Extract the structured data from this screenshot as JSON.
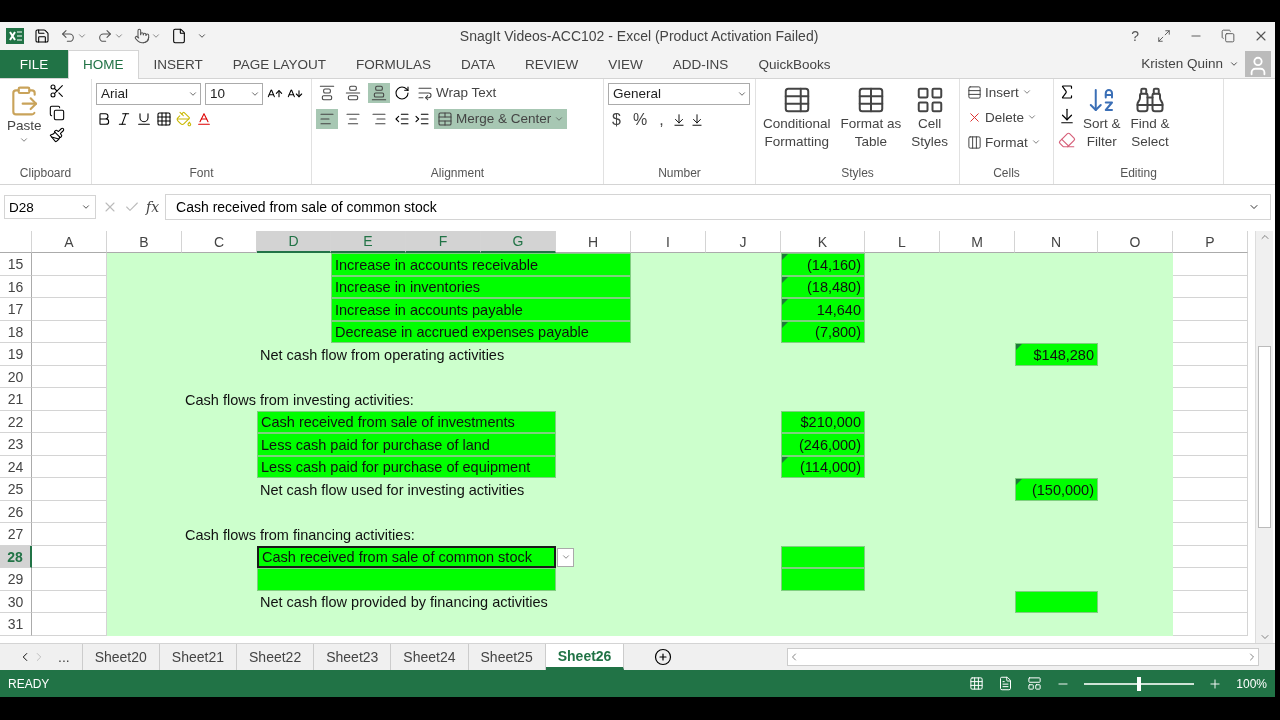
{
  "window": {
    "title": "SnagIt Videos-ACC102 - Excel (Product Activation Failed)",
    "help": "?"
  },
  "menu_tabs": [
    {
      "label": "FILE",
      "kind": "file",
      "selected": false
    },
    {
      "label": "HOME",
      "kind": "tab",
      "selected": true
    },
    {
      "label": "INSERT",
      "kind": "tab",
      "selected": false
    },
    {
      "label": "PAGE LAYOUT",
      "kind": "tab",
      "selected": false
    },
    {
      "label": "FORMULAS",
      "kind": "tab",
      "selected": false
    },
    {
      "label": "DATA",
      "kind": "tab",
      "selected": false
    },
    {
      "label": "REVIEW",
      "kind": "tab",
      "selected": false
    },
    {
      "label": "VIEW",
      "kind": "tab",
      "selected": false
    },
    {
      "label": "ADD-INS",
      "kind": "tab",
      "selected": false
    },
    {
      "label": "QuickBooks",
      "kind": "tab",
      "selected": false
    }
  ],
  "user": {
    "name": "Kristen Quinn"
  },
  "ribbon": {
    "clipboard": {
      "label": "Clipboard",
      "paste": "Paste"
    },
    "font": {
      "label": "Font",
      "font_name": "Arial",
      "font_size": "10"
    },
    "alignment": {
      "label": "Alignment",
      "vertical": [
        {
          "selected": false
        },
        {
          "selected": false
        },
        {
          "selected": true
        }
      ],
      "horizontal": [
        {
          "selected": true
        },
        {
          "selected": false
        },
        {
          "selected": false
        }
      ],
      "wrap_text": "Wrap Text",
      "merge": {
        "label": "Merge & Center",
        "selected": true
      }
    },
    "number": {
      "label": "Number",
      "format": "General",
      "symbols": [
        "$",
        "%",
        ","
      ]
    },
    "styles": {
      "label": "Styles",
      "buttons": [
        {
          "line1": "Conditional",
          "line2": "Formatting"
        },
        {
          "line1": "Format as",
          "line2": "Table"
        },
        {
          "line1": "Cell",
          "line2": "Styles"
        }
      ]
    },
    "cells": {
      "label": "Cells",
      "buttons": [
        "Insert",
        "Delete",
        "Format"
      ]
    },
    "editing": {
      "label": "Editing",
      "buttons": [
        {
          "line1": "Sort &",
          "line2": "Filter"
        },
        {
          "line1": "Find &",
          "line2": "Select"
        }
      ]
    }
  },
  "formula_bar": {
    "name_box": "D28",
    "fx": "fx",
    "formula": "Cash received from sale of common stock"
  },
  "columns": [
    {
      "label": "A",
      "selected": false
    },
    {
      "label": "B",
      "selected": false
    },
    {
      "label": "C",
      "selected": false
    },
    {
      "label": "D",
      "selected": true
    },
    {
      "label": "E",
      "selected": true
    },
    {
      "label": "F",
      "selected": true
    },
    {
      "label": "G",
      "selected": true
    },
    {
      "label": "H",
      "selected": false
    },
    {
      "label": "I",
      "selected": false
    },
    {
      "label": "J",
      "selected": false
    },
    {
      "label": "K",
      "selected": false
    },
    {
      "label": "L",
      "selected": false
    },
    {
      "label": "M",
      "selected": false
    },
    {
      "label": "N",
      "selected": false
    },
    {
      "label": "O",
      "selected": false
    },
    {
      "label": "P",
      "selected": false
    }
  ],
  "rows": [
    {
      "number": "15",
      "selected": false,
      "cells": [
        {
          "kind": "item-indented",
          "text": "Increase in accounts receivable",
          "flagged": false,
          "selected": false
        },
        {
          "kind": "amount",
          "text": "(14,160)",
          "flagged": true,
          "selected": false
        }
      ]
    },
    {
      "number": "16",
      "selected": false,
      "cells": [
        {
          "kind": "item-indented",
          "text": "Increase in inventories",
          "flagged": false,
          "selected": false
        },
        {
          "kind": "amount",
          "text": "(18,480)",
          "flagged": true,
          "selected": false
        }
      ]
    },
    {
      "number": "17",
      "selected": false,
      "cells": [
        {
          "kind": "item-indented",
          "text": "Increase in accounts payable",
          "flagged": false,
          "selected": false
        },
        {
          "kind": "amount",
          "text": "14,640",
          "flagged": true,
          "selected": false
        }
      ]
    },
    {
      "number": "18",
      "selected": false,
      "cells": [
        {
          "kind": "item-indented",
          "text": "Decrease in accrued expenses payable",
          "flagged": false,
          "selected": false
        },
        {
          "kind": "amount",
          "text": "(7,800)",
          "flagged": true,
          "selected": false
        }
      ]
    },
    {
      "number": "19",
      "selected": false,
      "cells": [
        {
          "kind": "total-label",
          "text": "Net cash flow from operating activities",
          "flagged": false,
          "selected": false
        },
        {
          "kind": "total",
          "text": "$148,280",
          "flagged": true,
          "selected": false
        }
      ]
    },
    {
      "number": "20",
      "selected": false
    },
    {
      "number": "21",
      "selected": false,
      "cells": [
        {
          "kind": "heading",
          "text": "Cash flows from investing activities:",
          "flagged": false,
          "selected": false
        }
      ]
    },
    {
      "number": "22",
      "selected": false,
      "cells": [
        {
          "kind": "item",
          "text": "Cash received from sale of investments",
          "flagged": false,
          "selected": false
        },
        {
          "kind": "amount",
          "text": "$210,000",
          "flagged": false,
          "selected": false
        }
      ]
    },
    {
      "number": "23",
      "selected": false,
      "cells": [
        {
          "kind": "item",
          "text": "Less cash paid for purchase of land",
          "flagged": false,
          "selected": false
        },
        {
          "kind": "amount",
          "text": "(246,000)",
          "flagged": false,
          "selected": false
        }
      ]
    },
    {
      "number": "24",
      "selected": false,
      "cells": [
        {
          "kind": "item",
          "text": "Less cash paid for purchase of equipment",
          "flagged": false,
          "selected": false
        },
        {
          "kind": "amount",
          "text": "(114,000)",
          "flagged": true,
          "selected": false
        }
      ]
    },
    {
      "number": "25",
      "selected": false,
      "cells": [
        {
          "kind": "total-label",
          "text": "Net cash flow used for investing activities",
          "flagged": false,
          "selected": false
        },
        {
          "kind": "total",
          "text": "(150,000)",
          "flagged": true,
          "selected": false
        }
      ]
    },
    {
      "number": "26",
      "selected": false
    },
    {
      "number": "27",
      "selected": false,
      "cells": [
        {
          "kind": "heading",
          "text": "Cash flows from financing activities:",
          "flagged": false,
          "selected": false
        }
      ]
    },
    {
      "number": "28",
      "selected": true,
      "cells": [
        {
          "kind": "item",
          "text": "Cash received from sale of common stock",
          "flagged": false,
          "selected": true
        },
        {
          "kind": "amount",
          "flagged": false,
          "selected": false
        }
      ]
    },
    {
      "number": "29",
      "selected": false,
      "cells": [
        {
          "kind": "item",
          "flagged": false,
          "selected": false
        },
        {
          "kind": "amount",
          "flagged": false,
          "selected": false
        }
      ]
    },
    {
      "number": "30",
      "selected": false,
      "cells": [
        {
          "kind": "total-label",
          "text": "Net cash flow provided by financing activities",
          "flagged": false,
          "selected": false
        },
        {
          "kind": "total",
          "flagged": false,
          "selected": false
        }
      ]
    },
    {
      "number": "31",
      "selected": false
    }
  ],
  "sheet_tabs": [
    {
      "label": "...",
      "selected": false
    },
    {
      "label": "Sheet20",
      "selected": false
    },
    {
      "label": "Sheet21",
      "selected": false
    },
    {
      "label": "Sheet22",
      "selected": false
    },
    {
      "label": "Sheet23",
      "selected": false
    },
    {
      "label": "Sheet24",
      "selected": false
    },
    {
      "label": "Sheet25",
      "selected": false
    },
    {
      "label": "Sheet26",
      "selected": true
    }
  ],
  "status_bar": {
    "status": "READY",
    "zoom": "100%",
    "zoom_slider": {
      "level": 0.5
    }
  }
}
